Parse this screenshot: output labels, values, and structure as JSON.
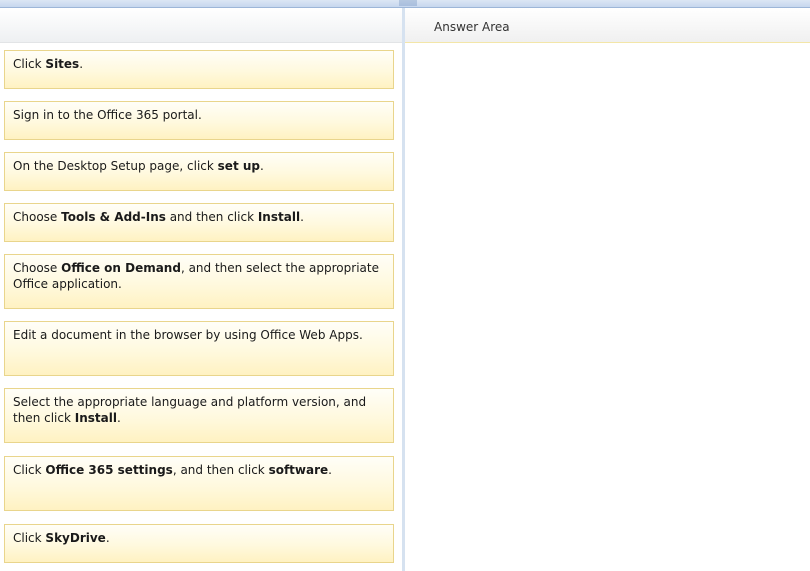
{
  "answer_area": {
    "title": "Answer Area"
  },
  "items": [
    {
      "parts": [
        {
          "t": "Click "
        },
        {
          "b": "Sites"
        },
        {
          "t": "."
        }
      ]
    },
    {
      "parts": [
        {
          "t": "Sign in to the Office 365 portal."
        }
      ]
    },
    {
      "parts": [
        {
          "t": "On the Desktop Setup page, click "
        },
        {
          "b": "set up"
        },
        {
          "t": "."
        }
      ]
    },
    {
      "parts": [
        {
          "t": "Choose "
        },
        {
          "b": "Tools & Add-Ins"
        },
        {
          "t": " and then click "
        },
        {
          "b": "Install"
        },
        {
          "t": "."
        }
      ]
    },
    {
      "parts": [
        {
          "t": "Choose "
        },
        {
          "b": "Office on Demand"
        },
        {
          "t": ", and then select the appropriate Office application."
        }
      ]
    },
    {
      "parts": [
        {
          "t": "Edit a document in the browser by using Office Web Apps."
        }
      ]
    },
    {
      "parts": [
        {
          "t": "Select the appropriate language and platform version, and then click "
        },
        {
          "b": "Install"
        },
        {
          "t": "."
        }
      ]
    },
    {
      "parts": [
        {
          "t": "Click "
        },
        {
          "b": "Office 365 settings"
        },
        {
          "t": ", and then click "
        },
        {
          "b": "software"
        },
        {
          "t": "."
        }
      ]
    },
    {
      "parts": [
        {
          "t": "Click "
        },
        {
          "b": "SkyDrive"
        },
        {
          "t": "."
        }
      ]
    }
  ]
}
